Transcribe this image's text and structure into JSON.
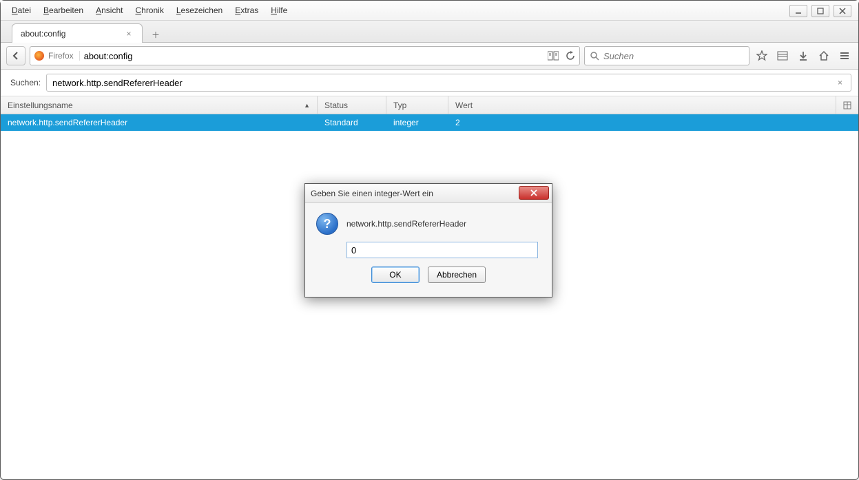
{
  "menu": {
    "datei": "Datei",
    "bearbeiten": "Bearbeiten",
    "ansicht": "Ansicht",
    "chronik": "Chronik",
    "lesezeichen": "Lesezeichen",
    "extras": "Extras",
    "hilfe": "Hilfe"
  },
  "tab": {
    "title": "about:config"
  },
  "urlbar": {
    "identity": "Firefox",
    "url": "about:config"
  },
  "searchbar": {
    "placeholder": "Suchen"
  },
  "filter": {
    "label": "Suchen:",
    "value": "network.http.sendRefererHeader"
  },
  "columns": {
    "name": "Einstellungsname",
    "status": "Status",
    "type": "Typ",
    "value": "Wert"
  },
  "rows": [
    {
      "name": "network.http.sendRefererHeader",
      "status": "Standard",
      "type": "integer",
      "value": "2"
    }
  ],
  "dialog": {
    "title": "Geben Sie einen integer-Wert ein",
    "pref": "network.http.sendRefererHeader",
    "input": "0",
    "ok": "OK",
    "cancel": "Abbrechen"
  }
}
